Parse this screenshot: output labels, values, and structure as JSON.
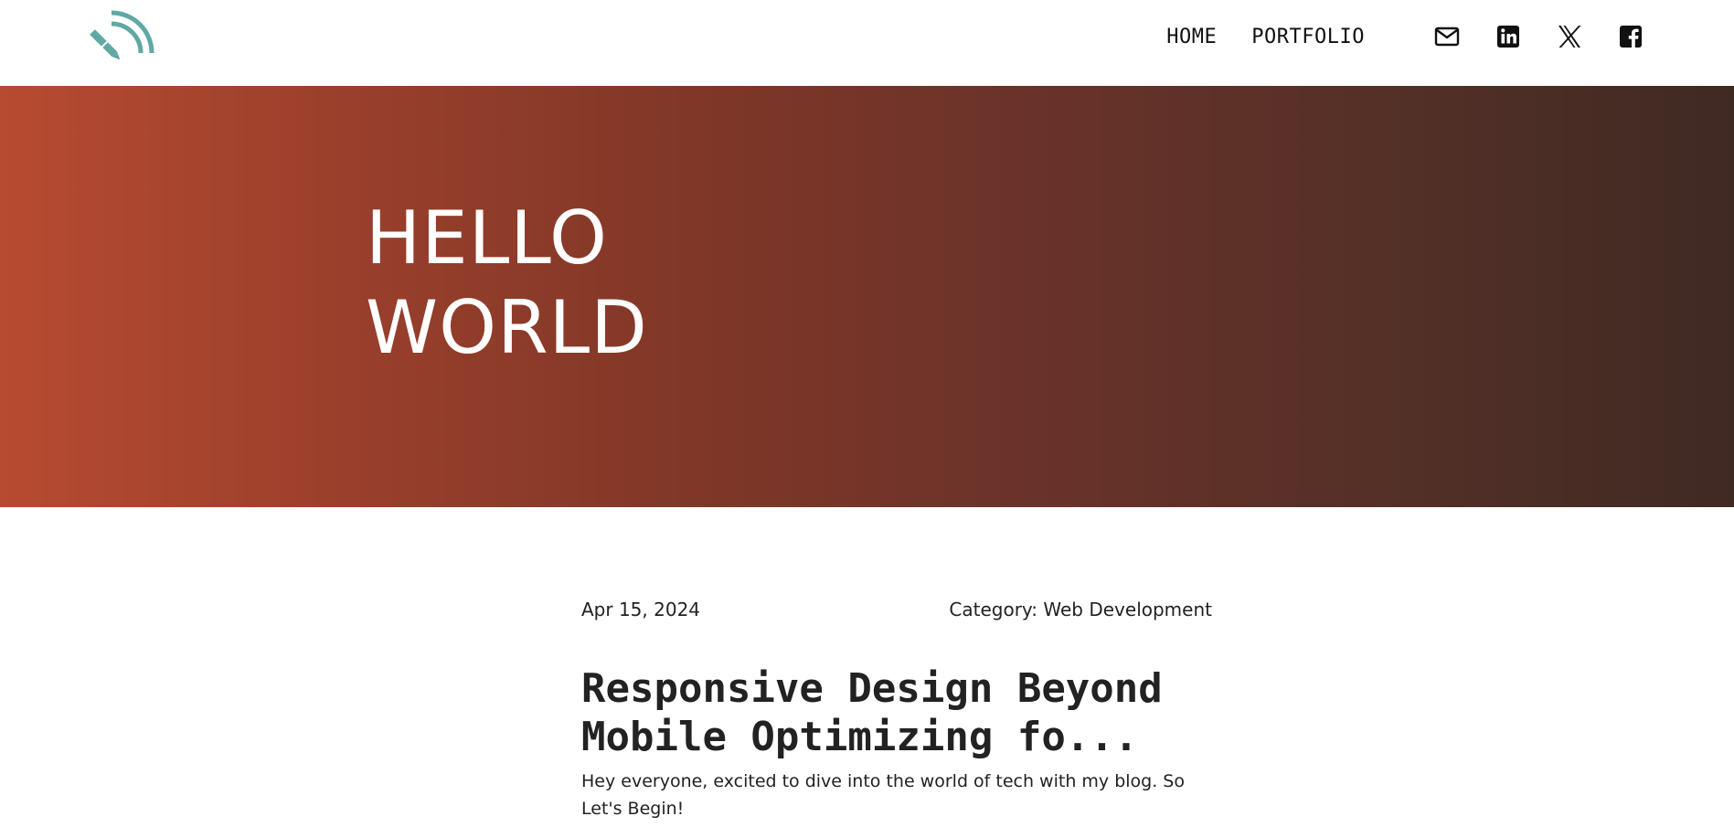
{
  "header": {
    "logo_icon": "pen-signal-icon",
    "nav": {
      "home_label": "HOME",
      "portfolio_label": "PORTFOLIO"
    },
    "social": [
      {
        "name": "mail-icon"
      },
      {
        "name": "linkedin-icon"
      },
      {
        "name": "x-icon"
      },
      {
        "name": "facebook-icon"
      }
    ]
  },
  "hero": {
    "title_line1": "HELLO",
    "title_line2": "WORLD",
    "gradient_start": "#b74b31",
    "gradient_end": "#3f2a23"
  },
  "post": {
    "date": "Apr 15, 2024",
    "category": "Category: Web Development",
    "title": "Responsive Design Beyond Mobile Optimizing fo...",
    "excerpt": "Hey everyone, excited to dive into the world of tech with my blog. So Let's Begin!"
  },
  "colors": {
    "logo_accent": "#5fa8a4",
    "text": "#222222"
  }
}
